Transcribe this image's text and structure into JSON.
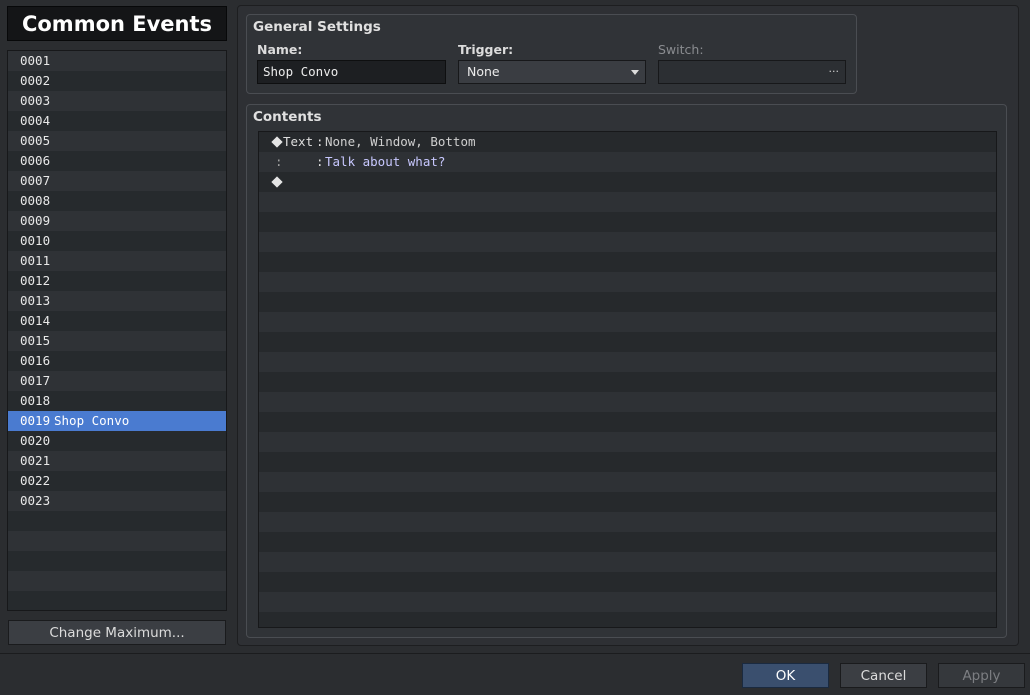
{
  "left_panel": {
    "title": "Common Events",
    "events": [
      {
        "id": "0001",
        "name": ""
      },
      {
        "id": "0002",
        "name": ""
      },
      {
        "id": "0003",
        "name": ""
      },
      {
        "id": "0004",
        "name": ""
      },
      {
        "id": "0005",
        "name": ""
      },
      {
        "id": "0006",
        "name": ""
      },
      {
        "id": "0007",
        "name": ""
      },
      {
        "id": "0008",
        "name": ""
      },
      {
        "id": "0009",
        "name": ""
      },
      {
        "id": "0010",
        "name": ""
      },
      {
        "id": "0011",
        "name": ""
      },
      {
        "id": "0012",
        "name": ""
      },
      {
        "id": "0013",
        "name": ""
      },
      {
        "id": "0014",
        "name": ""
      },
      {
        "id": "0015",
        "name": ""
      },
      {
        "id": "0016",
        "name": ""
      },
      {
        "id": "0017",
        "name": ""
      },
      {
        "id": "0018",
        "name": ""
      },
      {
        "id": "0019",
        "name": "Shop Convo",
        "selected": true
      },
      {
        "id": "0020",
        "name": ""
      },
      {
        "id": "0021",
        "name": ""
      },
      {
        "id": "0022",
        "name": ""
      },
      {
        "id": "0023",
        "name": ""
      }
    ],
    "change_max_label": "Change Maximum..."
  },
  "general_settings": {
    "title": "General Settings",
    "name_label": "Name:",
    "name_value": "Shop Convo",
    "trigger_label": "Trigger:",
    "trigger_value": "None",
    "switch_label": "Switch:",
    "switch_value": "",
    "switch_button": "···"
  },
  "contents": {
    "title": "Contents",
    "commands": [
      {
        "type": "command",
        "name": "Text",
        "colon": ":",
        "params": "None, Window, Bottom"
      },
      {
        "type": "continuation",
        "mark": ":",
        "colon": ":",
        "text": "Talk about what?"
      },
      {
        "type": "empty"
      }
    ],
    "total_rows": 25
  },
  "buttons": {
    "ok": "OK",
    "cancel": "Cancel",
    "apply": "Apply"
  },
  "colors": {
    "selection": "#4a7bd0",
    "background": "#2b2d30",
    "dialogue_text": "#c8c8ff"
  }
}
